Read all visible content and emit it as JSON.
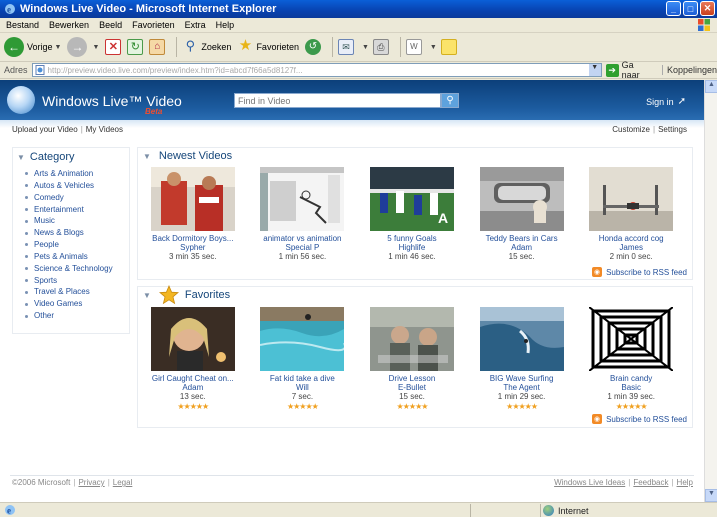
{
  "window": {
    "title": "Windows Live Video - Microsoft Internet Explorer",
    "controls": [
      "_",
      "□",
      "✕"
    ]
  },
  "menu": [
    "Bestand",
    "Bewerken",
    "Beeld",
    "Favorieten",
    "Extra",
    "Help"
  ],
  "toolbar": {
    "back": "Vorige",
    "search": "Zoeken",
    "favorites": "Favorieten"
  },
  "address": {
    "label": "Adres",
    "url": "http://preview.video.live.com/preview/index.htm?id=abcd7f66a5d8127f...",
    "go": "Ga naar",
    "links": "Koppelingen"
  },
  "site": {
    "brand": "Windows Live™ Video",
    "beta": "Beta",
    "search_placeholder": "Find in Video",
    "signin": "Sign in",
    "upload": "Upload your Video",
    "my_videos": "My Videos",
    "customize": "Customize",
    "settings": "Settings"
  },
  "category": {
    "title": "Category",
    "items": [
      "Arts & Animation",
      "Autos & Vehicles",
      "Comedy",
      "Entertainment",
      "Music",
      "News & Blogs",
      "People",
      "Pets & Animals",
      "Science & Technology",
      "Sports",
      "Travel & Places",
      "Video Games",
      "Other"
    ]
  },
  "newest": {
    "title": "Newest Videos",
    "rss": "Subscribe to RSS feed",
    "videos": [
      {
        "title": "Back Dormitory Boys...",
        "user": "Sypher",
        "duration": "3 min 35 sec."
      },
      {
        "title": "animator vs animation",
        "user": "Special P",
        "duration": "1 min 56 sec."
      },
      {
        "title": "5 funny Goals",
        "user": "Highlife",
        "duration": "1 min 46 sec."
      },
      {
        "title": "Teddy Bears in Cars",
        "user": "Adam",
        "duration": "15 sec."
      },
      {
        "title": "Honda accord cog",
        "user": "James",
        "duration": "2 min 0 sec."
      }
    ]
  },
  "favorites": {
    "title": "Favorites",
    "rss": "Subscribe to RSS feed",
    "videos": [
      {
        "title": "Girl Caught Cheat on...",
        "user": "Adam",
        "duration": "13 sec.",
        "rating": "★★★★★"
      },
      {
        "title": "Fat kid take a dive",
        "user": "Will",
        "duration": "7 sec.",
        "rating": "★★★★★"
      },
      {
        "title": "Drive Lesson",
        "user": "E-Bullet",
        "duration": "15 sec.",
        "rating": "★★★★★"
      },
      {
        "title": "BIG Wave Surfing",
        "user": "The Agent",
        "duration": "1 min 29 sec.",
        "rating": "★★★★★"
      },
      {
        "title": "Brain candy",
        "user": "Basic",
        "duration": "1 min 39 sec.",
        "rating": "★★★★★"
      }
    ]
  },
  "footer": {
    "copyright": "©2006 Microsoft",
    "privacy": "Privacy",
    "legal": "Legal",
    "ideas": "Windows Live Ideas",
    "feedback": "Feedback",
    "help": "Help"
  },
  "status": {
    "zone": "Internet"
  },
  "colors": {
    "link": "#24509a",
    "heading": "#15467a",
    "banner": "#1c5b9f",
    "rss": "#f28a26"
  }
}
